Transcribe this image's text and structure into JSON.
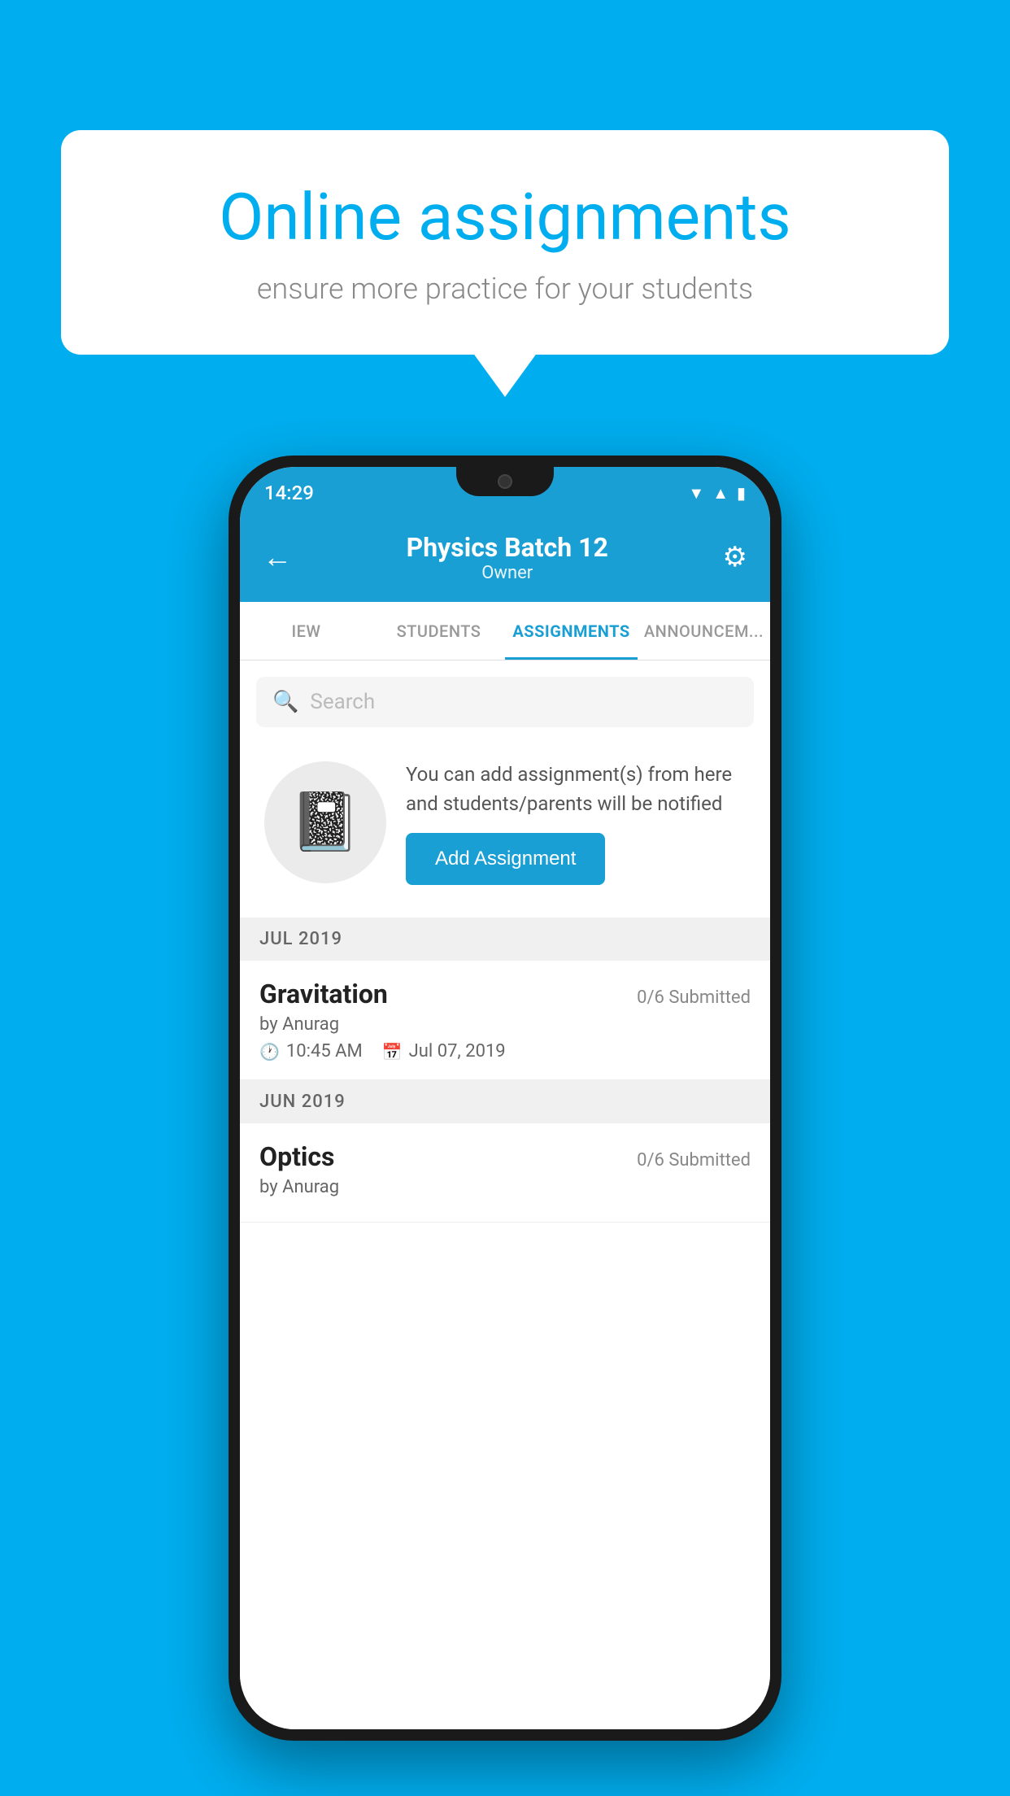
{
  "background_color": "#00AEEF",
  "speech_bubble": {
    "title": "Online assignments",
    "subtitle": "ensure more practice for your students"
  },
  "phone": {
    "status_bar": {
      "time": "14:29",
      "icons": [
        "wifi",
        "signal",
        "battery"
      ]
    },
    "header": {
      "back_label": "←",
      "title": "Physics Batch 12",
      "subtitle": "Owner",
      "settings_label": "⚙"
    },
    "tabs": [
      {
        "label": "IEW",
        "active": false
      },
      {
        "label": "STUDENTS",
        "active": false
      },
      {
        "label": "ASSIGNMENTS",
        "active": true
      },
      {
        "label": "ANNOUNCEM...",
        "active": false
      }
    ],
    "search": {
      "placeholder": "Search"
    },
    "promo": {
      "text": "You can add assignment(s) from here and students/parents will be notified",
      "button_label": "Add Assignment"
    },
    "sections": [
      {
        "header": "JUL 2019",
        "items": [
          {
            "name": "Gravitation",
            "submitted": "0/6 Submitted",
            "author": "by Anurag",
            "time": "10:45 AM",
            "date": "Jul 07, 2019"
          }
        ]
      },
      {
        "header": "JUN 2019",
        "items": [
          {
            "name": "Optics",
            "submitted": "0/6 Submitted",
            "author": "by Anurag",
            "time": "",
            "date": ""
          }
        ]
      }
    ]
  }
}
